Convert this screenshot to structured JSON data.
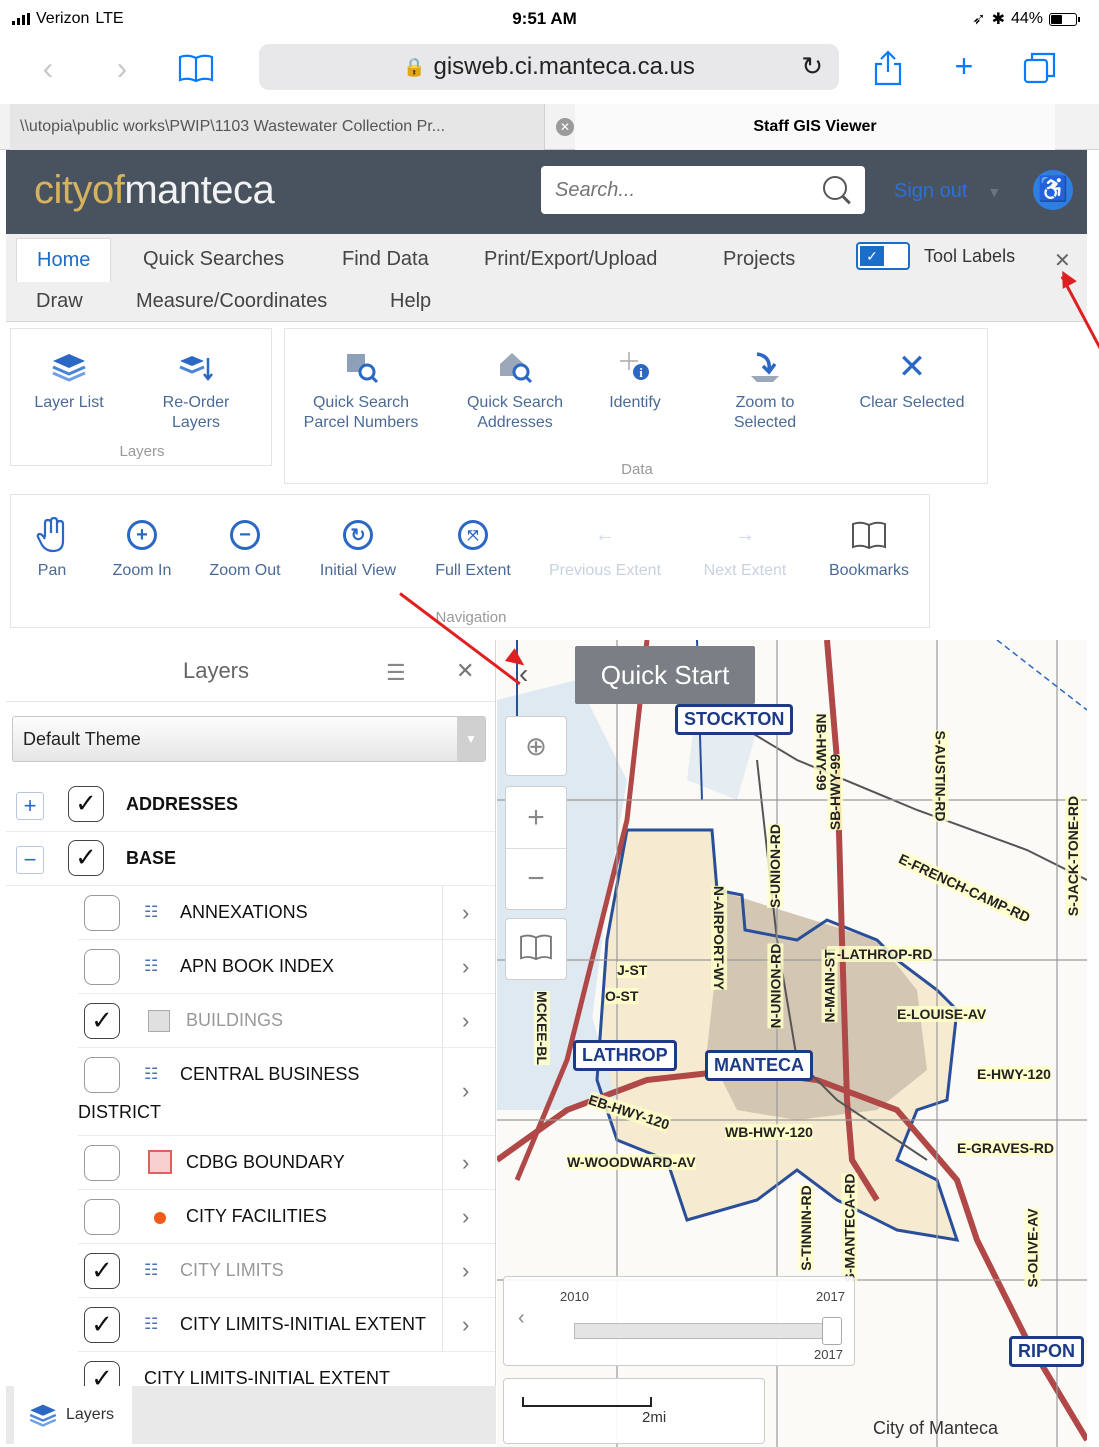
{
  "status": {
    "carrier": "Verizon",
    "network": "LTE",
    "time": "9:51 AM",
    "battery": "44%",
    "battery_level": 0.44
  },
  "browser": {
    "url": "gisweb.ci.manteca.ca.us",
    "tabs": [
      {
        "label": "\\\\utopia\\public works\\PWIP\\1103 Wastewater Collection Pr..."
      },
      {
        "label": "Staff GIS Viewer"
      }
    ]
  },
  "header": {
    "logo_a": "cityof",
    "logo_b": "manteca",
    "search_placeholder": "Search...",
    "signout": "Sign out"
  },
  "ribbon": {
    "tabs_row1": [
      "Home",
      "Quick Searches",
      "Find Data",
      "Print/Export/Upload",
      "Projects"
    ],
    "tabs_row2": [
      "Draw",
      "Measure/Coordinates",
      "Help"
    ],
    "tool_labels": "Tool Labels",
    "groups": {
      "layers": {
        "label": "Layers",
        "tools": [
          {
            "label": "Layer List"
          },
          {
            "label": "Re-Order Layers"
          }
        ]
      },
      "data": {
        "label": "Data",
        "tools": [
          {
            "label": "Quick Search Parcel Numbers"
          },
          {
            "label": "Quick Search Addresses"
          },
          {
            "label": "Identify"
          },
          {
            "label": "Zoom to Selected"
          },
          {
            "label": "Clear Selected"
          }
        ]
      },
      "navigation": {
        "label": "Navigation",
        "tools": [
          {
            "label": "Pan"
          },
          {
            "label": "Zoom In"
          },
          {
            "label": "Zoom Out"
          },
          {
            "label": "Initial View"
          },
          {
            "label": "Full Extent"
          },
          {
            "label": "Previous Extent"
          },
          {
            "label": "Next Extent"
          },
          {
            "label": "Bookmarks"
          }
        ]
      }
    }
  },
  "layers_panel": {
    "title": "Layers",
    "theme": "Default Theme",
    "layers": [
      {
        "name": "ADDRESSES",
        "checked": true
      },
      {
        "name": "BASE",
        "checked": true
      },
      {
        "name": "ANNEXATIONS",
        "checked": false
      },
      {
        "name": "APN BOOK INDEX",
        "checked": false
      },
      {
        "name": "BUILDINGS",
        "checked": true
      },
      {
        "name": "CENTRAL BUSINESS",
        "name2": "DISTRICT",
        "checked": false
      },
      {
        "name": "CDBG BOUNDARY",
        "checked": false
      },
      {
        "name": "CITY FACILITIES",
        "checked": false
      },
      {
        "name": "CITY LIMITS",
        "checked": true
      },
      {
        "name": "CITY LIMITS-INITIAL EXTENT",
        "checked": true
      },
      {
        "name": "CITY LIMITS-INITIAL EXTENT",
        "checked": true
      }
    ],
    "footer_button": "Layers"
  },
  "map": {
    "quick_start": "Quick Start",
    "cities": [
      "STOCKTON",
      "LATHROP",
      "MANTECA",
      "RIPON"
    ],
    "roads": [
      "E-FRENCH-CAMP-RD",
      "E-LATHROP-RD",
      "E-LOUISE-AV",
      "E-HWY-120",
      "E-GRAVES-RD",
      "W-WOODWARD-AV",
      "WB-HWY-120",
      "EB-HWY-120",
      "J-ST",
      "O-ST"
    ],
    "vertical_roads": [
      "S-AUSTIN-RD",
      "S-JACK-TONE-RD",
      "S-UNION-RD",
      "SB-HWY-99",
      "NB-HWY-99",
      "N-UNION-RD",
      "N-MAIN-ST",
      "N-AIRPORT-WY",
      "MCKEE-BL",
      "S-OLIVE-AV",
      "S-MANTECA-RD",
      "S-TINNIN-RD"
    ],
    "timeline": {
      "start": "2010",
      "end": "2017",
      "value": "2017"
    },
    "scale_label": "2mi",
    "attribution": "City of Manteca"
  }
}
